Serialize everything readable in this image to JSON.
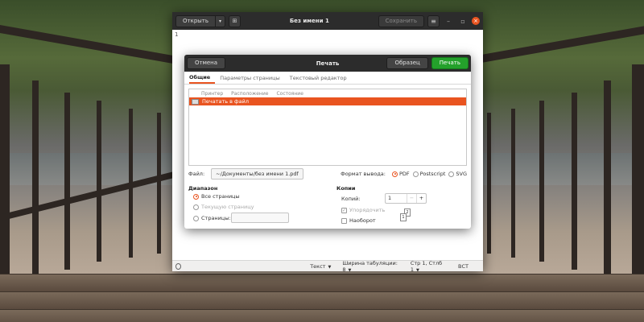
{
  "editor": {
    "open_label": "Открыть",
    "title": "Без имени 1",
    "save_label": "Сохранить",
    "line_number": "1",
    "status": {
      "mode": "Текст",
      "tab_width": "Ширина табуляции: 8",
      "cursor": "Стр 1, Стлб 1",
      "insert_mode": "ВСТ"
    }
  },
  "print_dialog": {
    "cancel_label": "Отмена",
    "title": "Печать",
    "preview_label": "Образец",
    "print_label": "Печать",
    "tabs": [
      {
        "label": "Общие",
        "active": true
      },
      {
        "label": "Параметры страницы",
        "active": false
      },
      {
        "label": "Текстовый редактор",
        "active": false
      }
    ],
    "printer_columns": [
      "Принтер",
      "Расположение",
      "Состояние"
    ],
    "printers": [
      {
        "name": "Печатать в файл",
        "selected": true
      }
    ],
    "file_label": "Файл:",
    "file_value": "~/Документы/без имени 1.pdf",
    "format_label": "Формат вывода:",
    "formats": [
      {
        "label": "PDF",
        "selected": true
      },
      {
        "label": "Postscript",
        "selected": false
      },
      {
        "label": "SVG",
        "selected": false
      }
    ],
    "range": {
      "title": "Диапазон",
      "all_pages": "Все страницы",
      "current_page": "Текущую страницу",
      "pages": "Страницы:",
      "pages_value": ""
    },
    "copies": {
      "title": "Копии",
      "copies_label": "Копий:",
      "copies_value": "1",
      "collate": "Упорядочить",
      "reverse": "Наоборот",
      "minus": "−",
      "plus": "+"
    }
  },
  "colors": {
    "accent": "#e95420",
    "confirm": "#24a12b",
    "header_dark": "#2c2c2c"
  },
  "icons": {
    "open_arrow": "chevron-down-icon",
    "new_doc": "new-document-icon",
    "menu": "hamburger-menu-icon",
    "minimize": "minimize-icon",
    "maximize": "maximize-icon",
    "close": "close-icon",
    "printer": "printer-icon"
  }
}
